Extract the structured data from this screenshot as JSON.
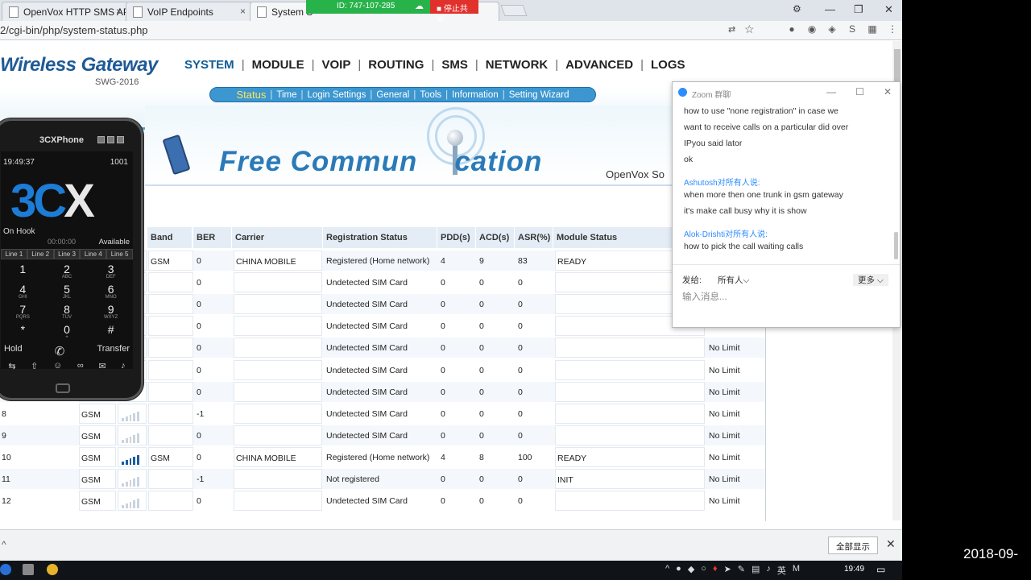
{
  "browser": {
    "tabs": [
      {
        "title": "OpenVox HTTP SMS AP",
        "close": "×"
      },
      {
        "title": "VoIP Endpoints",
        "close": "×"
      },
      {
        "title": "System S",
        "close": ""
      }
    ],
    "share_id": "ID: 747-107-285",
    "share_stop": "停止共享",
    "url": "2/cgi-bin/php/system-status.php",
    "window_controls": [
      "—",
      "❐",
      "✕"
    ]
  },
  "gateway": {
    "brand": "Wireless Gateway",
    "model": "SWG-2016",
    "nav": [
      "SYSTEM",
      "MODULE",
      "VOIP",
      "ROUTING",
      "SMS",
      "NETWORK",
      "ADVANCED",
      "LOGS"
    ],
    "subnav": [
      "Status",
      "Time",
      "Login Settings",
      "General",
      "Tools",
      "Information",
      "Setting Wizard"
    ],
    "banner_title_a": "Free Commun",
    "banner_title_b": "cation",
    "banner_company": "OpenVox So"
  },
  "table": {
    "headers": {
      "band": "Band",
      "ber": "BER",
      "carrier": "Carrier",
      "reg": "Registration Status",
      "pdd": "PDD(s)",
      "acd": "ACD(s)",
      "asr": "ASR(%)",
      "module": "Module Status"
    },
    "rows": [
      {
        "port": "",
        "type": "",
        "band": "GSM",
        "ber": "0",
        "carrier": "CHINA MOBILE",
        "reg": "Registered (Home network)",
        "pdd": "4",
        "acd": "9",
        "asr": "83",
        "module": "READY",
        "limit": ""
      },
      {
        "port": "",
        "type": "",
        "band": "",
        "ber": "0",
        "carrier": "",
        "reg": "Undetected SIM Card",
        "pdd": "0",
        "acd": "0",
        "asr": "0",
        "module": "",
        "limit": ""
      },
      {
        "port": "",
        "type": "",
        "band": "",
        "ber": "0",
        "carrier": "",
        "reg": "Undetected SIM Card",
        "pdd": "0",
        "acd": "0",
        "asr": "0",
        "module": "",
        "limit": ""
      },
      {
        "port": "",
        "type": "",
        "band": "",
        "ber": "0",
        "carrier": "",
        "reg": "Undetected SIM Card",
        "pdd": "0",
        "acd": "0",
        "asr": "0",
        "module": "",
        "limit": ""
      },
      {
        "port": "",
        "type": "",
        "band": "",
        "ber": "0",
        "carrier": "",
        "reg": "Undetected SIM Card",
        "pdd": "0",
        "acd": "0",
        "asr": "0",
        "module": "",
        "limit": "No Limit"
      },
      {
        "port": "",
        "type": "",
        "band": "",
        "ber": "0",
        "carrier": "",
        "reg": "Undetected SIM Card",
        "pdd": "0",
        "acd": "0",
        "asr": "0",
        "module": "",
        "limit": "No Limit"
      },
      {
        "port": "",
        "type": "",
        "band": "",
        "ber": "0",
        "carrier": "",
        "reg": "Undetected SIM Card",
        "pdd": "0",
        "acd": "0",
        "asr": "0",
        "module": "",
        "limit": "No Limit"
      },
      {
        "port": "8",
        "type": "GSM",
        "band": "",
        "ber": "-1",
        "carrier": "",
        "reg": "Undetected SIM Card",
        "pdd": "0",
        "acd": "0",
        "asr": "0",
        "module": "",
        "limit": "No Limit"
      },
      {
        "port": "9",
        "type": "GSM",
        "band": "",
        "ber": "0",
        "carrier": "",
        "reg": "Undetected SIM Card",
        "pdd": "0",
        "acd": "0",
        "asr": "0",
        "module": "",
        "limit": "No Limit"
      },
      {
        "port": "10",
        "type": "GSM",
        "band": "GSM",
        "ber": "0",
        "carrier": "CHINA MOBILE",
        "reg": "Registered (Home network)",
        "pdd": "4",
        "acd": "8",
        "asr": "100",
        "module": "READY",
        "limit": "No Limit",
        "signal": "full"
      },
      {
        "port": "11",
        "type": "GSM",
        "band": "",
        "ber": "-1",
        "carrier": "",
        "reg": "Not registered",
        "pdd": "0",
        "acd": "0",
        "asr": "0",
        "module": "INIT",
        "limit": "No Limit"
      },
      {
        "port": "12",
        "type": "GSM",
        "band": "",
        "ber": "0",
        "carrier": "",
        "reg": "Undetected SIM Card",
        "pdd": "0",
        "acd": "0",
        "asr": "0",
        "module": "",
        "limit": "No Limit"
      }
    ]
  },
  "phone": {
    "title": "3CXPhone",
    "time": "19:49:37",
    "extension": "1001",
    "logo_a": "3C",
    "logo_b": "X",
    "hook": "On Hook",
    "timer": "00:00:00",
    "availability": "Available",
    "lines": [
      "Line 1",
      "Line 2",
      "Line 3",
      "Line 4",
      "Line 5"
    ],
    "keys": [
      {
        "d": "1",
        "l": ""
      },
      {
        "d": "2",
        "l": "ABC"
      },
      {
        "d": "3",
        "l": "DEF"
      },
      {
        "d": "4",
        "l": "GHI"
      },
      {
        "d": "5",
        "l": "JKL"
      },
      {
        "d": "6",
        "l": "MNO"
      },
      {
        "d": "7",
        "l": "PQRS"
      },
      {
        "d": "8",
        "l": "TUV"
      },
      {
        "d": "9",
        "l": "WXYZ"
      },
      {
        "d": "*",
        "l": ""
      },
      {
        "d": "0",
        "l": "+"
      },
      {
        "d": "#",
        "l": ""
      }
    ],
    "hold": "Hold",
    "transfer": "Transfer"
  },
  "zoom": {
    "title": "Zoom 群聊",
    "messages": [
      "how to use \"none registration\" in case we",
      "want to receive calls on a particular did over",
      "IPyou said lator",
      "ok"
    ],
    "sender1": "Ashutosh对所有人说:",
    "messages2": [
      "when more then one trunk in gsm gateway",
      "it's make call busy why it is show"
    ],
    "sender2": "Alok-Drishti对所有人说:",
    "messages3": [
      "how to pick the call waiting calls"
    ],
    "to_label": "发给:",
    "recipient": "所有人⌵",
    "more": "更多 ⌵",
    "input_placeholder": "输入消息..."
  },
  "downloads": {
    "show_all": "全部显示",
    "close": "✕"
  },
  "taskbar": {
    "ime": "英",
    "clock": "19:49"
  },
  "overlay_date": "2018-09-"
}
